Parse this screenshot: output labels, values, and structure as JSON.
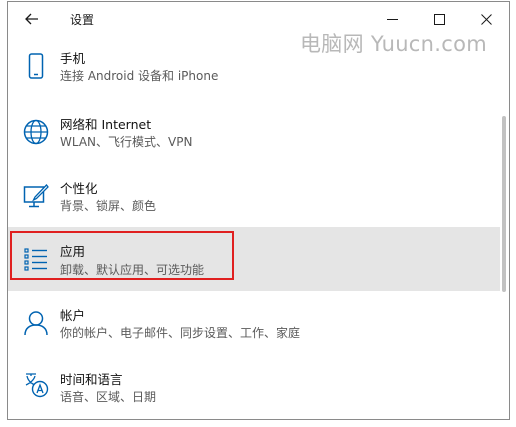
{
  "window": {
    "title": "设置"
  },
  "watermark": "电脑网 Yuucn.com",
  "items": [
    {
      "label": "手机",
      "desc": "连接 Android 设备和 iPhone",
      "icon": "phone-icon"
    },
    {
      "label": "网络和 Internet",
      "desc": "WLAN、飞行模式、VPN",
      "icon": "globe-icon"
    },
    {
      "label": "个性化",
      "desc": "背景、锁屏、颜色",
      "icon": "personalization-icon"
    },
    {
      "label": "应用",
      "desc": "卸载、默认应用、可选功能",
      "icon": "apps-list-icon",
      "selected": true
    },
    {
      "label": "帐户",
      "desc": "你的帐户、电子邮件、同步设置、工作、家庭",
      "icon": "person-icon"
    },
    {
      "label": "时间和语言",
      "desc": "语音、区域、日期",
      "icon": "time-language-icon"
    }
  ],
  "colors": {
    "selected_bg": "#e5e5e5",
    "icon": "#0063b1",
    "highlight": "#e02020"
  }
}
